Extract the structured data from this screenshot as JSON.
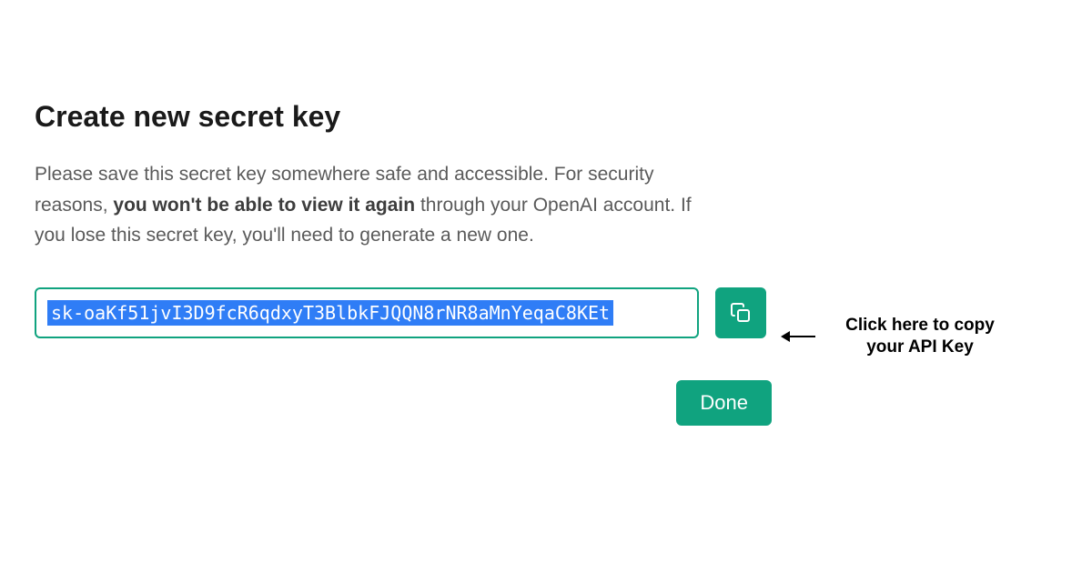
{
  "dialog": {
    "title": "Create new secret key",
    "desc_part1": "Please save this secret key somewhere safe and accessible. For security reasons, ",
    "desc_bold": "you won't be able to view it again",
    "desc_part2": " through your OpenAI account. If you lose this secret key, you'll need to generate a new one.",
    "secret_key_value": "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",
    "done_label": "Done"
  },
  "annotation": {
    "text": "Click here to copy your API Key"
  },
  "colors": {
    "accent": "#10a37f",
    "selection": "#2f7df6"
  }
}
